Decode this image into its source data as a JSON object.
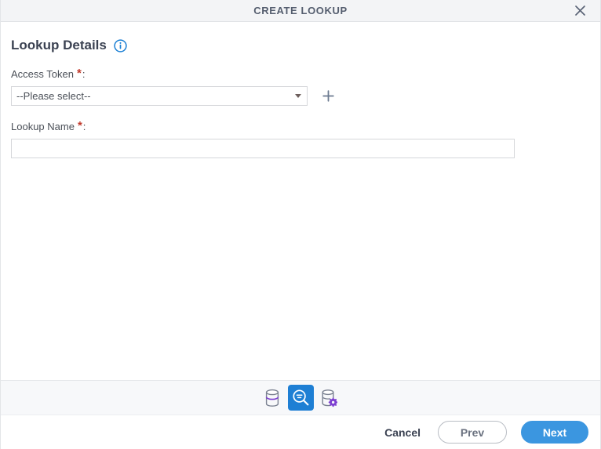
{
  "window": {
    "title": "CREATE LOOKUP",
    "close_icon": "close-icon"
  },
  "section": {
    "title": "Lookup Details",
    "info_icon": "info-circle-icon"
  },
  "fields": {
    "access_token": {
      "label": "Access Token",
      "required_marker": "*",
      "colon": ":",
      "selected_value": "--Please select--",
      "caret_icon": "chevron-down-icon",
      "add_icon": "plus-icon"
    },
    "lookup_name": {
      "label": "Lookup Name",
      "required_marker": "*",
      "colon": ":",
      "value": "",
      "placeholder": ""
    }
  },
  "steps": [
    {
      "name": "database-icon",
      "label": "Data Source",
      "active": false
    },
    {
      "name": "lookup-search-icon",
      "label": "Lookup Details",
      "active": true
    },
    {
      "name": "database-settings-icon",
      "label": "Lookup Configuration",
      "active": false
    }
  ],
  "footer": {
    "cancel_label": "Cancel",
    "prev_label": "Prev",
    "next_label": "Next"
  },
  "colors": {
    "accent_blue": "#3b96e0",
    "active_step_blue": "#1e7fd4",
    "info_blue": "#1a7fd4",
    "required_red": "#c0392b",
    "title_gray": "#545d6e",
    "purple_accent": "#7d3fd1"
  }
}
